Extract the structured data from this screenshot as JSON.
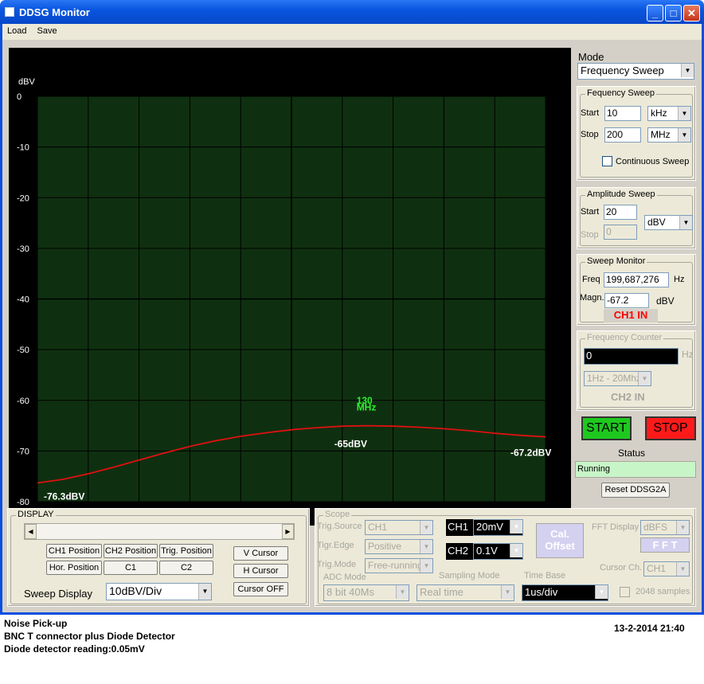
{
  "window": {
    "title": "DDSG Monitor",
    "minimize": "_",
    "maximize": "□",
    "close": "✕"
  },
  "menu": [
    "Load",
    "Save"
  ],
  "chart_data": {
    "type": "line",
    "ylabel": "dBV",
    "y_ticks": [
      "0",
      "-10",
      "-20",
      "-30",
      "-40",
      "-50",
      "-60",
      "-70",
      "-80"
    ],
    "ylim": [
      -80,
      0
    ],
    "x_range_hz": [
      10000,
      200000000
    ],
    "grid": true,
    "series": [
      {
        "color": "#e01010",
        "x_mhz": [
          0.01,
          10,
          20,
          30,
          40,
          50,
          60,
          70,
          80,
          90,
          100,
          110,
          120,
          130,
          140,
          150,
          160,
          170,
          180,
          190,
          200
        ],
        "values": [
          -76.3,
          -75.6,
          -74.5,
          -73.2,
          -71.8,
          -70.4,
          -69.1,
          -68.0,
          -67.1,
          -66.4,
          -65.8,
          -65.4,
          -65.1,
          -65.0,
          -65.1,
          -65.3,
          -65.6,
          -66.0,
          -66.5,
          -66.9,
          -67.2
        ]
      }
    ],
    "annotations": {
      "marker_freq": "130",
      "marker_unit": "MHz",
      "peak_label": "-65dBV",
      "start_label": "-76.3dBV",
      "end_label": "-67.2dBV"
    }
  },
  "mode": {
    "label": "Mode",
    "value": "Frequency Sweep"
  },
  "freq_sweep": {
    "legend": "Fequency Sweep",
    "start_label": "Start",
    "start_value": "10",
    "start_unit": "kHz",
    "stop_label": "Stop",
    "stop_value": "200",
    "stop_unit": "MHz",
    "continuous_label": "Continuous Sweep"
  },
  "amp_sweep": {
    "legend": "Amplitude Sweep",
    "start_label": "Start",
    "start_value": "20",
    "stop_label": "Stop",
    "stop_value": "0",
    "unit": "dBV"
  },
  "sweep_monitor": {
    "legend": "Sweep Monitor",
    "freq_label": "Freq",
    "freq_value": "199,687,276",
    "freq_unit": "Hz",
    "magn_label": "Magn.",
    "magn_value": "-67.2",
    "magn_unit": "dBV",
    "channel": "CH1 IN"
  },
  "freq_counter": {
    "legend": "Frequency Counter",
    "value": "0",
    "unit": "Hz",
    "range": "1Hz - 20Mhz",
    "channel": "CH2 IN"
  },
  "controls": {
    "start": "START",
    "stop": "STOP",
    "status_label": "Status",
    "status_value": "Running",
    "reset": "Reset DDSG2A",
    "start_color": "#1ec81e",
    "stop_color": "#ff1a1a"
  },
  "display": {
    "legend": "DISPLAY",
    "ch1_pos": "CH1 Position",
    "ch2_pos": "CH2 Position",
    "trig_pos": "Trig. Position",
    "hor_pos": "Hor. Position",
    "c1": "C1",
    "c2": "C2",
    "v_cursor": "V Cursor",
    "h_cursor": "H Cursor",
    "cursor_off": "Cursor OFF",
    "sweep_display_label": "Sweep Display",
    "sweep_display_value": "10dBV/Div"
  },
  "scope": {
    "legend": "Scope",
    "trig_source_label": "Trig.Source",
    "trig_source_value": "CH1",
    "trig_edge_label": "Tigr.Edge",
    "trig_edge_value": "Positive",
    "trig_mode_label": "Trig.Mode",
    "trig_mode_value": "Free-running",
    "ch1_label": "CH1",
    "ch1_value": "20mV",
    "ch2_label": "CH2",
    "ch2_value": "0.1V",
    "cal_offset": "Cal. Offset",
    "fft_display_label": "FFT Display",
    "fft_display_value": "dBFS",
    "fft_button": "F F T",
    "cursor_ch_label": "Cursor Ch.",
    "cursor_ch_value": "CH1",
    "adc_mode_label": "ADC Mode",
    "adc_mode_value": "8 bit 40Ms",
    "sampling_mode_label": "Sampling Mode",
    "sampling_mode_value": "Real time",
    "time_base_label": "Time Base",
    "time_base_value": "1us/div",
    "samples_label": "2048 samples"
  },
  "notes": {
    "line1": "Noise Pick-up",
    "line2": "BNC T connector plus Diode Detector",
    "line3": "Diode detector reading:0.05mV",
    "timestamp": "13-2-2014 21:40"
  }
}
